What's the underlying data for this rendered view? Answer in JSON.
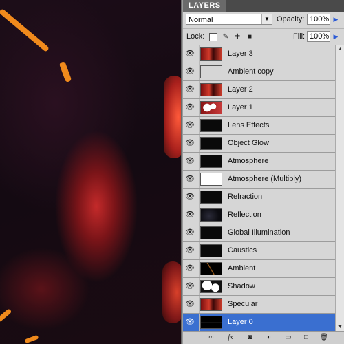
{
  "panel": {
    "tab_label": "LAYERS",
    "blend_mode": "Normal",
    "opacity_label": "Opacity:",
    "opacity_value": "100%",
    "lock_label": "Lock:",
    "fill_label": "Fill:",
    "fill_value": "100%"
  },
  "layers": [
    {
      "name": "Layer 3",
      "thumb": "red",
      "selected": false
    },
    {
      "name": "Ambient copy",
      "thumb": "transparent",
      "selected": false
    },
    {
      "name": "Layer 2",
      "thumb": "red",
      "selected": false
    },
    {
      "name": "Layer 1",
      "thumb": "red-white",
      "selected": false
    },
    {
      "name": "Lens Effects",
      "thumb": "black",
      "selected": false
    },
    {
      "name": "Object Glow",
      "thumb": "black",
      "selected": false
    },
    {
      "name": "Atmosphere",
      "thumb": "black",
      "selected": false
    },
    {
      "name": "Atmosphere (Multiply)",
      "thumb": "white",
      "selected": false
    },
    {
      "name": "Refraction",
      "thumb": "black",
      "selected": false
    },
    {
      "name": "Reflection",
      "thumb": "dark-noise",
      "selected": false
    },
    {
      "name": "Global Illumination",
      "thumb": "black",
      "selected": false
    },
    {
      "name": "Caustics",
      "thumb": "black",
      "selected": false
    },
    {
      "name": "Ambient",
      "thumb": "black-streak",
      "selected": false
    },
    {
      "name": "Shadow",
      "thumb": "bw",
      "selected": false
    },
    {
      "name": "Specular",
      "thumb": "red",
      "selected": false
    },
    {
      "name": "Layer 0",
      "thumb": "black-lines",
      "selected": true
    }
  ],
  "icons": {
    "visibility": "eye-icon",
    "lock_transparent": "lock-transparent-pixels-icon",
    "lock_image": "lock-image-pixels-icon",
    "lock_position": "lock-position-icon",
    "lock_all": "lock-all-icon",
    "footer": [
      "link-layers-icon",
      "layer-style-icon",
      "layer-mask-icon",
      "adjustment-layer-icon",
      "new-group-icon",
      "new-layer-icon",
      "delete-layer-icon"
    ]
  },
  "colors": {
    "selection": "#3a6fd0",
    "panel_bg": "#d6d6d6",
    "accent_arrow": "#2b5ad6"
  }
}
